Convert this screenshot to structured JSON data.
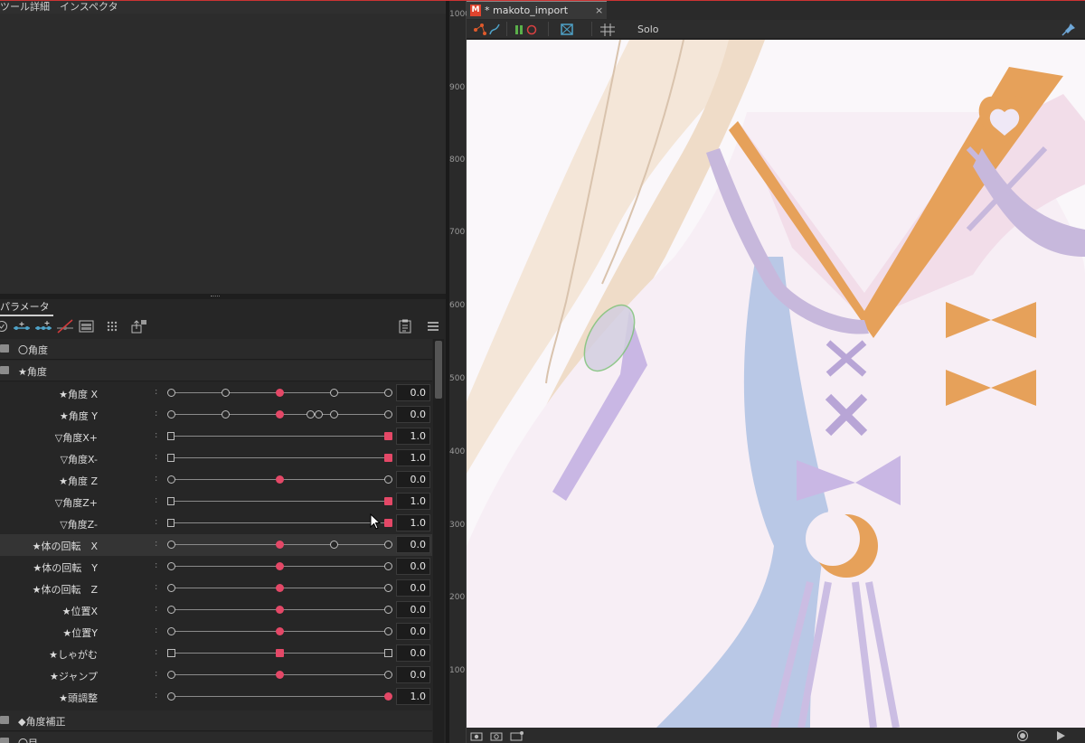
{
  "tool_panel": {
    "tabs": [
      "ツール詳細",
      "インスペクタ"
    ],
    "active_tab": "インスペクタ"
  },
  "parameter_panel": {
    "tab_label": "パラメータ",
    "toolbar_icons": [
      "check-icon",
      "add-parameter-icon",
      "add-key-icon",
      "delete-key-icon",
      "blend-shape-icon",
      "grid-icon",
      "export-icon",
      "copy-settings-icon",
      "menu-icon"
    ],
    "groups": [
      {
        "label": "〇角度"
      },
      {
        "label": "★角度"
      },
      {
        "label": "◆角度補正"
      },
      {
        "label": "〇目"
      }
    ],
    "params": [
      {
        "label": "★角度 X",
        "value": "0.0"
      },
      {
        "label": "★角度 Y",
        "value": "0.0"
      },
      {
        "label": "▽角度X+",
        "value": "1.0"
      },
      {
        "label": "▽角度X-",
        "value": "1.0"
      },
      {
        "label": "★角度 Z",
        "value": "0.0"
      },
      {
        "label": "▽角度Z+",
        "value": "1.0"
      },
      {
        "label": "▽角度Z-",
        "value": "1.0"
      },
      {
        "label": "★体の回転　X",
        "value": "0.0"
      },
      {
        "label": "★体の回転　Y",
        "value": "0.0"
      },
      {
        "label": "★体の回転　Z",
        "value": "0.0"
      },
      {
        "label": "★位置X",
        "value": "0.0"
      },
      {
        "label": "★位置Y",
        "value": "0.0"
      },
      {
        "label": "★しゃがむ",
        "value": "0.0"
      },
      {
        "label": "★ジャンプ",
        "value": "0.0"
      },
      {
        "label": "★頭調整",
        "value": "1.0"
      }
    ],
    "selected_param": "★体の回転　X"
  },
  "document": {
    "tab_title": "* makoto_import",
    "badge": "M",
    "close": "×"
  },
  "view_toolbar": {
    "solo_label": "Solo"
  },
  "ruler": {
    "ticks": [
      "1000",
      "900",
      "800",
      "700",
      "600",
      "500",
      "400",
      "300",
      "200",
      "100"
    ]
  },
  "colors": {
    "accent": "#e44867",
    "topline": "#cc3333",
    "badge": "#e0442e"
  }
}
